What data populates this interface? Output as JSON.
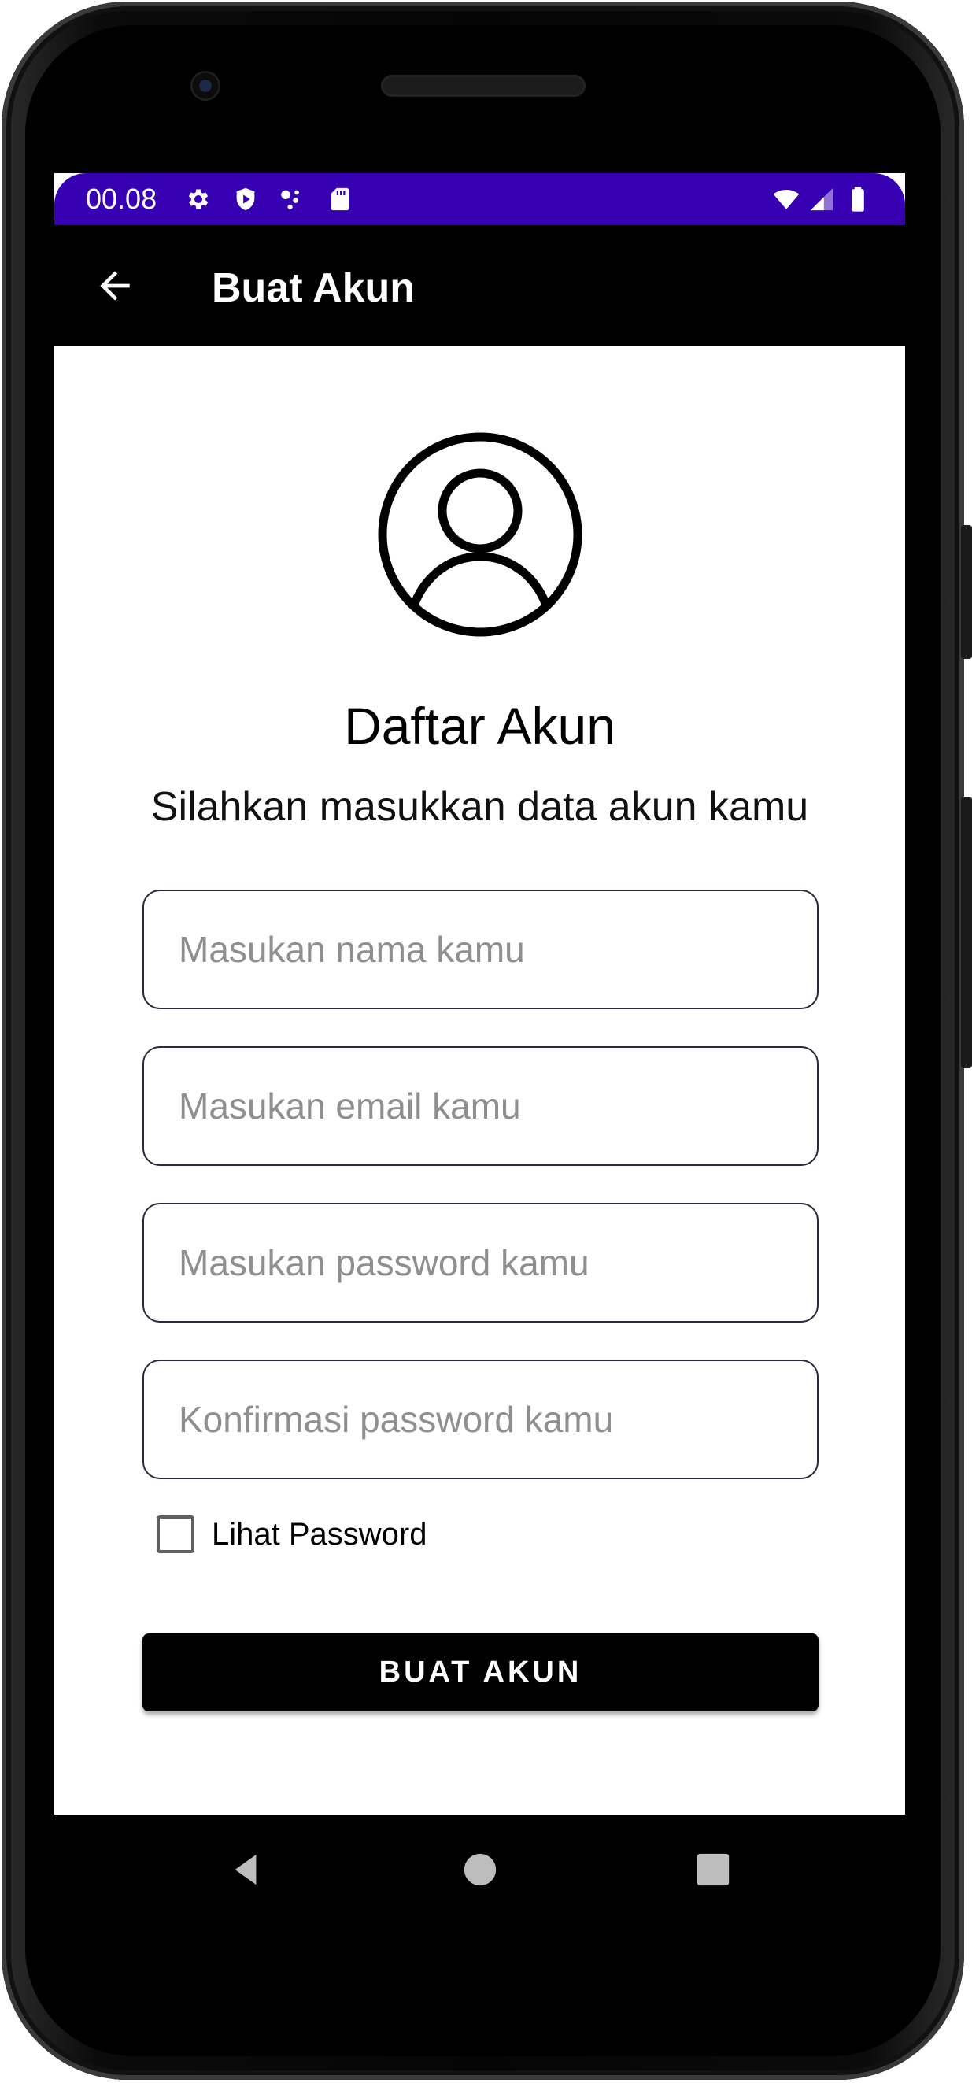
{
  "status_bar": {
    "time": "00.08",
    "background_color": "#3700b3",
    "left_icons": [
      "gear-icon",
      "shield-play-icon",
      "assistant-dots-icon",
      "sd-card-icon"
    ],
    "right_icons": [
      "wifi-icon",
      "cell-signal-icon",
      "battery-icon"
    ]
  },
  "app_bar": {
    "title": "Buat Akun",
    "back_icon": "arrow-left-icon"
  },
  "main": {
    "avatar_icon": "account-circle-icon",
    "title": "Daftar Akun",
    "subtitle": "Silahkan masukkan data akun kamu",
    "fields": [
      {
        "name": "name",
        "placeholder": "Masukan nama kamu",
        "value": ""
      },
      {
        "name": "email",
        "placeholder": "Masukan email kamu",
        "value": ""
      },
      {
        "name": "password",
        "placeholder": "Masukan password kamu",
        "value": ""
      },
      {
        "name": "confirm_password",
        "placeholder": "Konfirmasi password kamu",
        "value": ""
      }
    ],
    "show_password": {
      "label": "Lihat Password",
      "checked": false
    },
    "submit_label": "BUAT AKUN"
  },
  "nav_bar": {
    "buttons": [
      "back-triangle-icon",
      "home-circle-icon",
      "recents-square-icon"
    ]
  }
}
